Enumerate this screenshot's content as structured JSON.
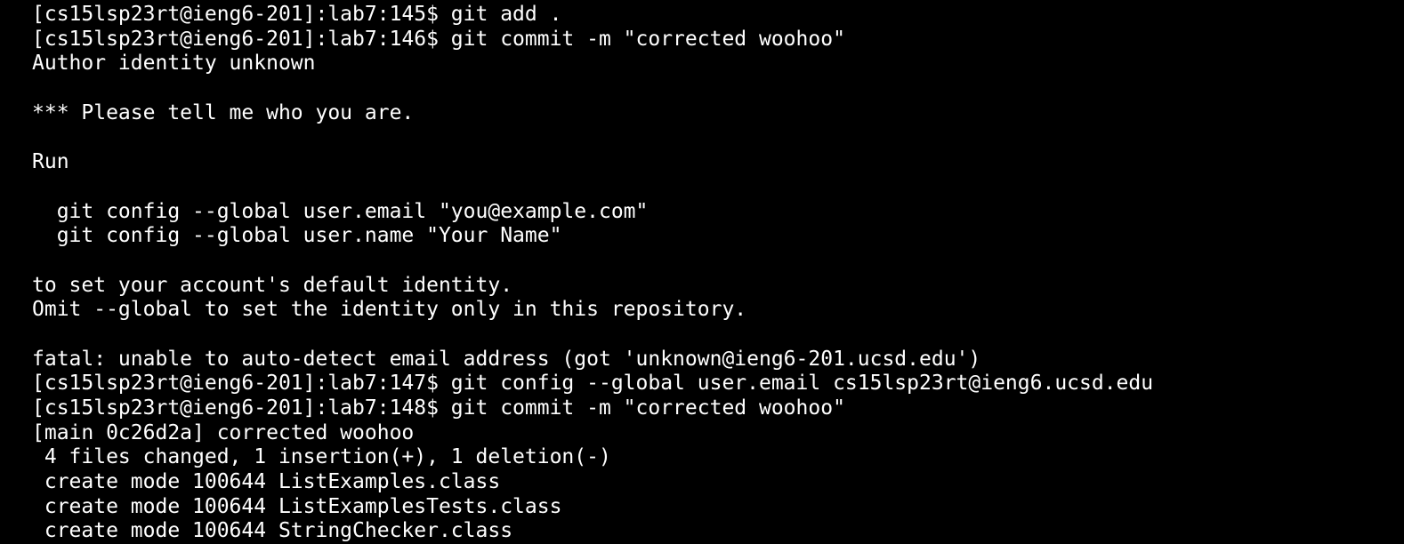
{
  "terminal": {
    "background_color": "#000000",
    "text_color": "#ffffff",
    "lines": [
      "[cs15lsp23rt@ieng6-201]:lab7:145$ git add .",
      "[cs15lsp23rt@ieng6-201]:lab7:146$ git commit -m \"corrected woohoo\"",
      "Author identity unknown",
      "",
      "*** Please tell me who you are.",
      "",
      "Run",
      "",
      "  git config --global user.email \"you@example.com\"",
      "  git config --global user.name \"Your Name\"",
      "",
      "to set your account's default identity.",
      "Omit --global to set the identity only in this repository.",
      "",
      "fatal: unable to auto-detect email address (got 'unknown@ieng6-201.ucsd.edu')",
      "[cs15lsp23rt@ieng6-201]:lab7:147$ git config --global user.email cs15lsp23rt@ieng6.ucsd.edu",
      "[cs15lsp23rt@ieng6-201]:lab7:148$ git commit -m \"corrected woohoo\"",
      "[main 0c26d2a] corrected woohoo",
      " 4 files changed, 1 insertion(+), 1 deletion(-)",
      " create mode 100644 ListExamples.class",
      " create mode 100644 ListExamplesTests.class",
      " create mode 100644 StringChecker.class"
    ]
  }
}
